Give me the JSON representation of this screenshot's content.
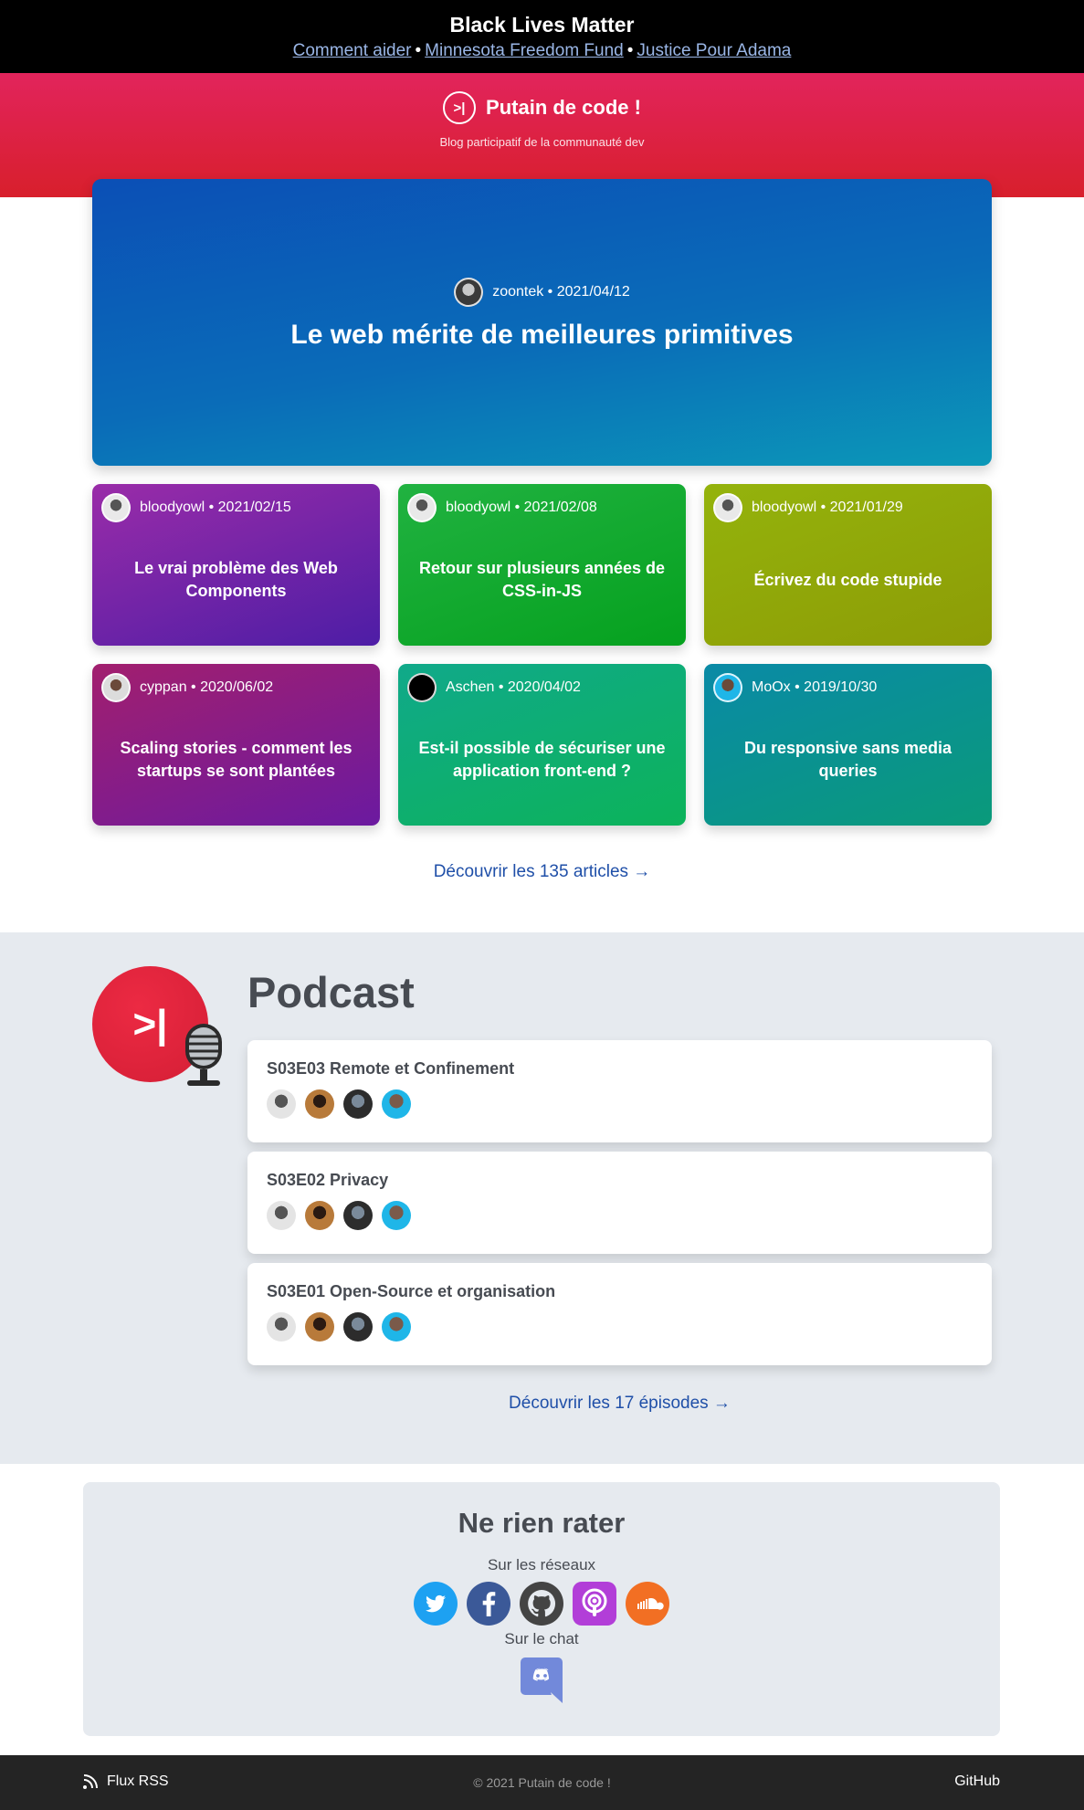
{
  "banner": {
    "title": "Black Lives Matter",
    "links": [
      "Comment aider",
      "Minnesota Freedom Fund",
      "Justice Pour Adama"
    ],
    "separator": "•"
  },
  "header": {
    "logo_text": ">|",
    "brand": "Putain de code !",
    "tagline": "Blog participatif de la communauté dev"
  },
  "featured": {
    "author": "zoontek",
    "date": "2021/04/12",
    "title": "Le web mérite de meilleures primitives"
  },
  "articles": [
    {
      "author": "bloodyowl",
      "date": "2021/02/15",
      "title": "Le vrai problème des Web Components",
      "color": "#7b2aa8"
    },
    {
      "author": "bloodyowl",
      "date": "2021/02/08",
      "title": "Retour sur plusieurs années de CSS-in-JS",
      "color": "#13a83a"
    },
    {
      "author": "bloodyowl",
      "date": "2021/01/29",
      "title": "Écrivez du code stupide",
      "color": "#8ca70f"
    },
    {
      "author": "cyppan",
      "date": "2020/06/02",
      "title": "Scaling stories - comment les startups se sont plantées",
      "color": "#8c1f7d"
    },
    {
      "author": "Aschen",
      "date": "2020/04/02",
      "title": "Est-il possible de sécuriser une application front-end ?",
      "color": "#13b07e"
    },
    {
      "author": "MoOx",
      "date": "2019/10/30",
      "title": "Du responsive sans media queries",
      "color": "#0a8aa0"
    }
  ],
  "more_articles": "Découvrir les 135 articles →",
  "podcast": {
    "logo_text": ">|",
    "title": "Podcast",
    "episodes": [
      {
        "title": "S03E03 Remote et Confinement"
      },
      {
        "title": "S03E02 Privacy"
      },
      {
        "title": "S03E01 Open-Source et organisation"
      }
    ],
    "more": "Découvrir les 17 épisodes →"
  },
  "follow": {
    "title": "Ne rien rater",
    "social_label": "Sur les réseaux",
    "socials": [
      "twitter-icon",
      "facebook-icon",
      "github-icon",
      "apple-podcasts-icon",
      "soundcloud-icon"
    ],
    "chat_label": "Sur le chat"
  },
  "footer": {
    "rss": "Flux RSS",
    "copyright": "© 2021 Putain de code !",
    "github": "GitHub"
  }
}
